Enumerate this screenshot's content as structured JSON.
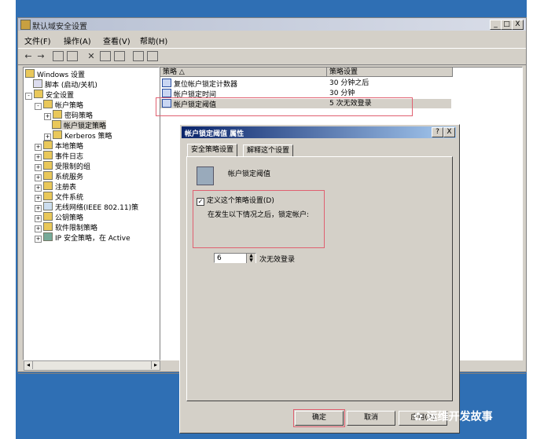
{
  "window": {
    "title": "默认域安全设置",
    "min": "_",
    "max": "□",
    "close": "X",
    "menu": [
      "文件(F)",
      "操作(A)",
      "查看(V)",
      "帮助(H)"
    ]
  },
  "tree": {
    "items": [
      {
        "label": "Windows 设置"
      },
      {
        "label": "脚本 (启动/关机)"
      },
      {
        "label": "安全设置"
      },
      {
        "label": "帐户策略"
      },
      {
        "label": "密码策略"
      },
      {
        "label": "帐户锁定策略"
      },
      {
        "label": "Kerberos 策略"
      },
      {
        "label": "本地策略"
      },
      {
        "label": "事件日志"
      },
      {
        "label": "受限制的组"
      },
      {
        "label": "系统服务"
      },
      {
        "label": "注册表"
      },
      {
        "label": "文件系统"
      },
      {
        "label": "无线网络(IEEE 802.11)策"
      },
      {
        "label": "公钥策略"
      },
      {
        "label": "软件限制策略"
      },
      {
        "label": "IP 安全策略，在 Active"
      }
    ]
  },
  "list": {
    "col_policy": "策略 △",
    "col_setting": "策略设置",
    "rows": [
      {
        "policy": "复位帐户锁定计数器",
        "setting": "30 分钟之后"
      },
      {
        "policy": "帐户锁定时间",
        "setting": "30 分钟"
      },
      {
        "policy": "帐户锁定阈值",
        "setting": "5 次无效登录"
      }
    ]
  },
  "dialog": {
    "title": "帐户锁定阈值 属性",
    "help": "?",
    "close": "X",
    "tab_security": "安全策略设置",
    "tab_explain": "解释这个设置",
    "policy_name": "帐户锁定阈值",
    "define_label": "定义这个策略设置(D)",
    "lock_desc": "在发生以下情况之后，锁定帐户:",
    "value": "6",
    "unit": "次无效登录",
    "ok": "确定",
    "cancel": "取消",
    "apply": "应用(A)"
  },
  "watermark": "运维开发故事"
}
